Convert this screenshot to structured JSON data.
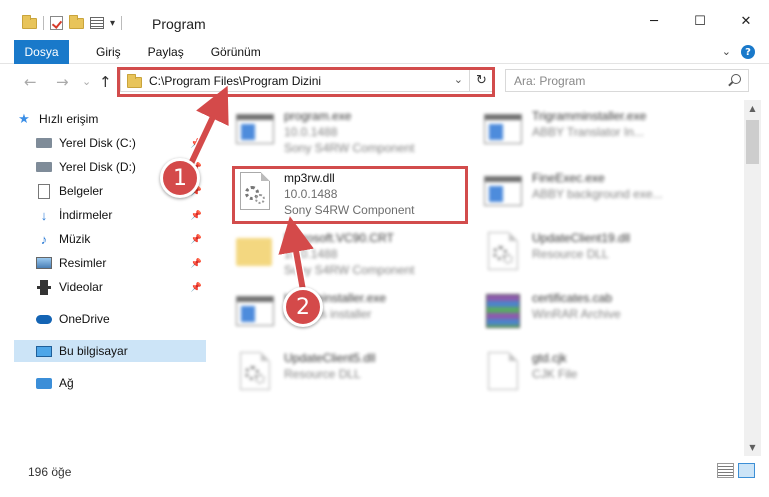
{
  "window": {
    "title": "Program"
  },
  "window_controls": {
    "minimize": "─",
    "maximize": "☐",
    "close": "✕"
  },
  "ribbon": {
    "tabs": [
      "Dosya",
      "Giriş",
      "Paylaş",
      "Görünüm"
    ],
    "expand_glyph": "⌄",
    "help_glyph": "?"
  },
  "nav": {
    "back": "←",
    "forward": "→",
    "recent": "⌄",
    "up": "↑",
    "address": "C:\\Program Files\\Program Dizini",
    "address_dropdown": "⌄",
    "refresh": "↻",
    "search_placeholder": "Ara: Program"
  },
  "sidebar": {
    "items": [
      {
        "label": "Hızlı erişim",
        "icon": "star-icon"
      },
      {
        "label": "Yerel Disk (C:)",
        "icon": "drive-icon"
      },
      {
        "label": "Yerel Disk (D:)",
        "icon": "drive-icon"
      },
      {
        "label": "Belgeler",
        "icon": "document-icon"
      },
      {
        "label": "İndirmeler",
        "icon": "download-icon"
      },
      {
        "label": "Müzik",
        "icon": "music-icon"
      },
      {
        "label": "Resimler",
        "icon": "pictures-icon"
      },
      {
        "label": "Videolar",
        "icon": "video-icon"
      },
      {
        "label": "OneDrive",
        "icon": "cloud-icon"
      },
      {
        "label": "Bu bilgisayar",
        "icon": "computer-icon"
      },
      {
        "label": "Ağ",
        "icon": "network-icon"
      }
    ]
  },
  "files": [
    {
      "name": "program.exe",
      "line1": "10.0.1488",
      "line2": "Sony S4RW Component"
    },
    {
      "name": "Trigramminstaller.exe",
      "line1": "ABBY Translator In...",
      "line2": ""
    },
    {
      "name": "mp3rw.dll",
      "line1": "10.0.1488",
      "line2": "Sony S4RW Component"
    },
    {
      "name": "FineExec.exe",
      "line1": "ABBY background exe...",
      "line2": ""
    },
    {
      "name": "Microsoft.VC90.CRT",
      "line1": "10.0.1488",
      "line2": "Sony S4RW Component"
    },
    {
      "name": "UpdateClient19.dll",
      "line1": "Resource DLL",
      "line2": ""
    },
    {
      "name": "Updateinstaller.exe",
      "line1": "updates installer",
      "line2": ""
    },
    {
      "name": "certificates.cab",
      "line1": "WinRAR Archive",
      "line2": ""
    },
    {
      "name": "UpdateClient5.dll",
      "line1": "Resource DLL",
      "line2": ""
    },
    {
      "name": "gtd.cjk",
      "line1": "CJK File",
      "line2": ""
    }
  ],
  "annotations": {
    "step1": "1",
    "step2": "2"
  },
  "status": {
    "item_count": "196 öğe"
  },
  "colors": {
    "accent": "#1979ca",
    "highlight": "#d24c4c",
    "selected": "#cce4f7"
  }
}
